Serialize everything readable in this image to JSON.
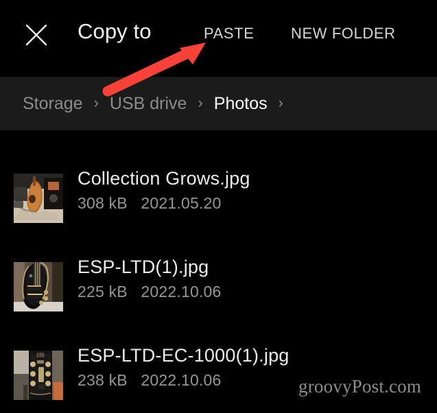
{
  "toolbar": {
    "close_icon": "close-icon",
    "title": "Copy to",
    "paste_label": "PASTE",
    "new_folder_label": "NEW FOLDER"
  },
  "breadcrumb": {
    "separator": "›",
    "items": [
      {
        "label": "Storage",
        "current": false
      },
      {
        "label": "USB drive",
        "current": false
      },
      {
        "label": "Photos",
        "current": true
      }
    ]
  },
  "files": [
    {
      "name": "Collection Grows.jpg",
      "size": "308 kB",
      "date": "2021.05.20",
      "thumbnail": "acoustic-guitar-on-floor"
    },
    {
      "name": "ESP-LTD(1).jpg",
      "size": "225 kB",
      "date": "2022.10.06",
      "thumbnail": "black-electric-guitar"
    },
    {
      "name": "ESP-LTD-EC-1000(1).jpg",
      "size": "238 kB",
      "date": "2022.10.06",
      "thumbnail": "guitar-headstock-closeup"
    }
  ],
  "annotation": {
    "arrow_icon": "red-arrow-pointing-to-paste",
    "color": "#f9423a"
  },
  "watermark": {
    "text": "groovyPost.com"
  },
  "colors": {
    "background": "#000000",
    "breadcrumb_background": "#1b1b1b",
    "primary_text": "#f2f2f2",
    "secondary_text": "#969696",
    "accent_red": "#f9423a"
  }
}
